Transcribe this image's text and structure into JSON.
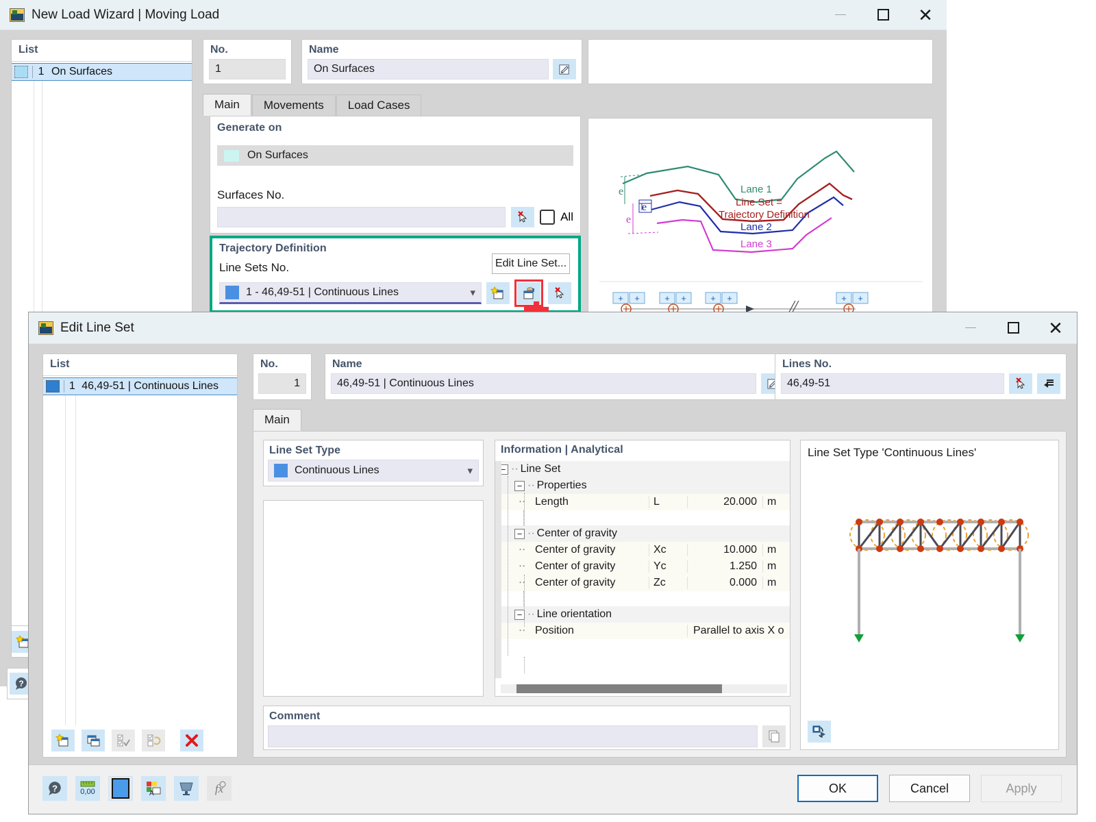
{
  "wizard": {
    "title": "New Load Wizard | Moving Load",
    "window_buttons": {
      "minimize": "minimize-icon",
      "maximize": "maximize-icon",
      "close": "close-icon"
    },
    "list_header": "List",
    "list_items": [
      {
        "no": "1",
        "label": "On Surfaces"
      }
    ],
    "no_header": "No.",
    "no_value": "1",
    "name_header": "Name",
    "name_value": "On Surfaces",
    "tabs": [
      {
        "label": "Main",
        "active": true
      },
      {
        "label": "Movements",
        "active": false
      },
      {
        "label": "Load Cases",
        "active": false
      }
    ],
    "generate_on": {
      "header": "Generate on",
      "selected": "On Surfaces",
      "swatch": "#ccf5f2",
      "surfaces_label": "Surfaces No.",
      "surfaces_value": "",
      "all_label": "All",
      "all_checked": false,
      "pick_icon": "pick-cursor-icon"
    },
    "trajectory": {
      "header": "Trajectory Definition",
      "line_sets_label": "Line Sets No.",
      "edit_button": "Edit Line Set...",
      "selected": "1 - 46,49-51 | Continuous Lines",
      "swatch": "#4a90e2",
      "highlight_color": "#00a884",
      "buttons": [
        {
          "name": "new-line-set-icon",
          "highlighted": false
        },
        {
          "name": "edit-line-set-icon",
          "highlighted": true
        },
        {
          "name": "pick-cursor-icon",
          "highlighted": false
        }
      ]
    },
    "diagram": {
      "lanes": [
        {
          "label": "Lane 1",
          "color": "#2e8b72"
        },
        {
          "label": "Lane 2",
          "color": "#1f2fa8"
        },
        {
          "label": "Lane 3",
          "color": "#d23bd2"
        }
      ],
      "annotation": "Line Set =\nTrajectory Definition",
      "annotation_line1": "Line Set =",
      "annotation_line2": "Trajectory Definition",
      "annotation_color": "#a52121",
      "eccentricity_labels": [
        "e",
        "e",
        "e"
      ],
      "plus_marks": 8
    },
    "side_icons": [
      {
        "name": "new-item-icon"
      },
      {
        "name": "help-icon"
      }
    ]
  },
  "line_set_dialog": {
    "title": "Edit Line Set",
    "window_buttons": {
      "minimize": "minimize-icon",
      "maximize": "maximize-icon",
      "close": "close-icon"
    },
    "list_header": "List",
    "list_items": [
      {
        "no": "1",
        "label": "46,49-51 | Continuous Lines",
        "swatch": "#2f7fd0"
      }
    ],
    "no_header": "No.",
    "no_value": "1",
    "name_header": "Name",
    "name_value": "46,49-51 | Continuous Lines",
    "name_edit_icon": "edit-name-icon",
    "lines_no_header": "Lines No.",
    "lines_no_value": "46,49-51",
    "lines_buttons": [
      {
        "name": "pick-cursor-icon"
      },
      {
        "name": "reverse-arrow-icon"
      }
    ],
    "tabs": [
      {
        "label": "Main",
        "active": true
      }
    ],
    "line_set_type": {
      "header": "Line Set Type",
      "value": "Continuous Lines",
      "swatch": "#4a90e2"
    },
    "information": {
      "header": "Information | Analytical",
      "rows": [
        {
          "kind": "group",
          "indent": 0,
          "label": "Line Set",
          "expander": "−"
        },
        {
          "kind": "group",
          "indent": 1,
          "label": "Properties",
          "expander": "−"
        },
        {
          "kind": "value",
          "indent": 2,
          "label": "Length",
          "symbol": "L",
          "value": "20.000",
          "unit": "m"
        },
        {
          "kind": "blank"
        },
        {
          "kind": "group",
          "indent": 1,
          "label": "Center of gravity",
          "expander": "−"
        },
        {
          "kind": "value",
          "indent": 2,
          "label": "Center of gravity",
          "symbol": "Xc",
          "value": "10.000",
          "unit": "m"
        },
        {
          "kind": "value",
          "indent": 2,
          "label": "Center of gravity",
          "symbol": "Yc",
          "value": "1.250",
          "unit": "m"
        },
        {
          "kind": "value",
          "indent": 2,
          "label": "Center of gravity",
          "symbol": "Zc",
          "value": "0.000",
          "unit": "m"
        },
        {
          "kind": "blank"
        },
        {
          "kind": "group",
          "indent": 1,
          "label": "Line orientation",
          "expander": "−"
        },
        {
          "kind": "long",
          "indent": 2,
          "label": "Position",
          "symbol": "",
          "value": "Parallel to axis X o"
        }
      ]
    },
    "preview": {
      "caption": "Line Set Type 'Continuous Lines'",
      "rotate_icon": "rotate-view-icon"
    },
    "comment": {
      "header": "Comment",
      "value": "",
      "copy_icon": "copy-comment-icon"
    },
    "list_toolbar": [
      {
        "name": "new-line-set-icon",
        "enabled": true
      },
      {
        "name": "copy-line-set-icon",
        "enabled": true
      },
      {
        "name": "select-all-icon",
        "enabled": false
      },
      {
        "name": "invert-selection-icon",
        "enabled": false
      },
      {
        "name": "delete-icon",
        "enabled": true
      }
    ],
    "bottom_toolbar": [
      {
        "name": "help-icon",
        "enabled": true
      },
      {
        "name": "units-icon",
        "enabled": true
      },
      {
        "name": "color-swatch-icon",
        "enabled": true
      },
      {
        "name": "display-properties-icon",
        "enabled": true
      },
      {
        "name": "visibility-icon",
        "enabled": true
      },
      {
        "name": "formula-icon",
        "enabled": false
      }
    ],
    "buttons": {
      "ok": "OK",
      "cancel": "Cancel",
      "apply": "Apply"
    }
  }
}
